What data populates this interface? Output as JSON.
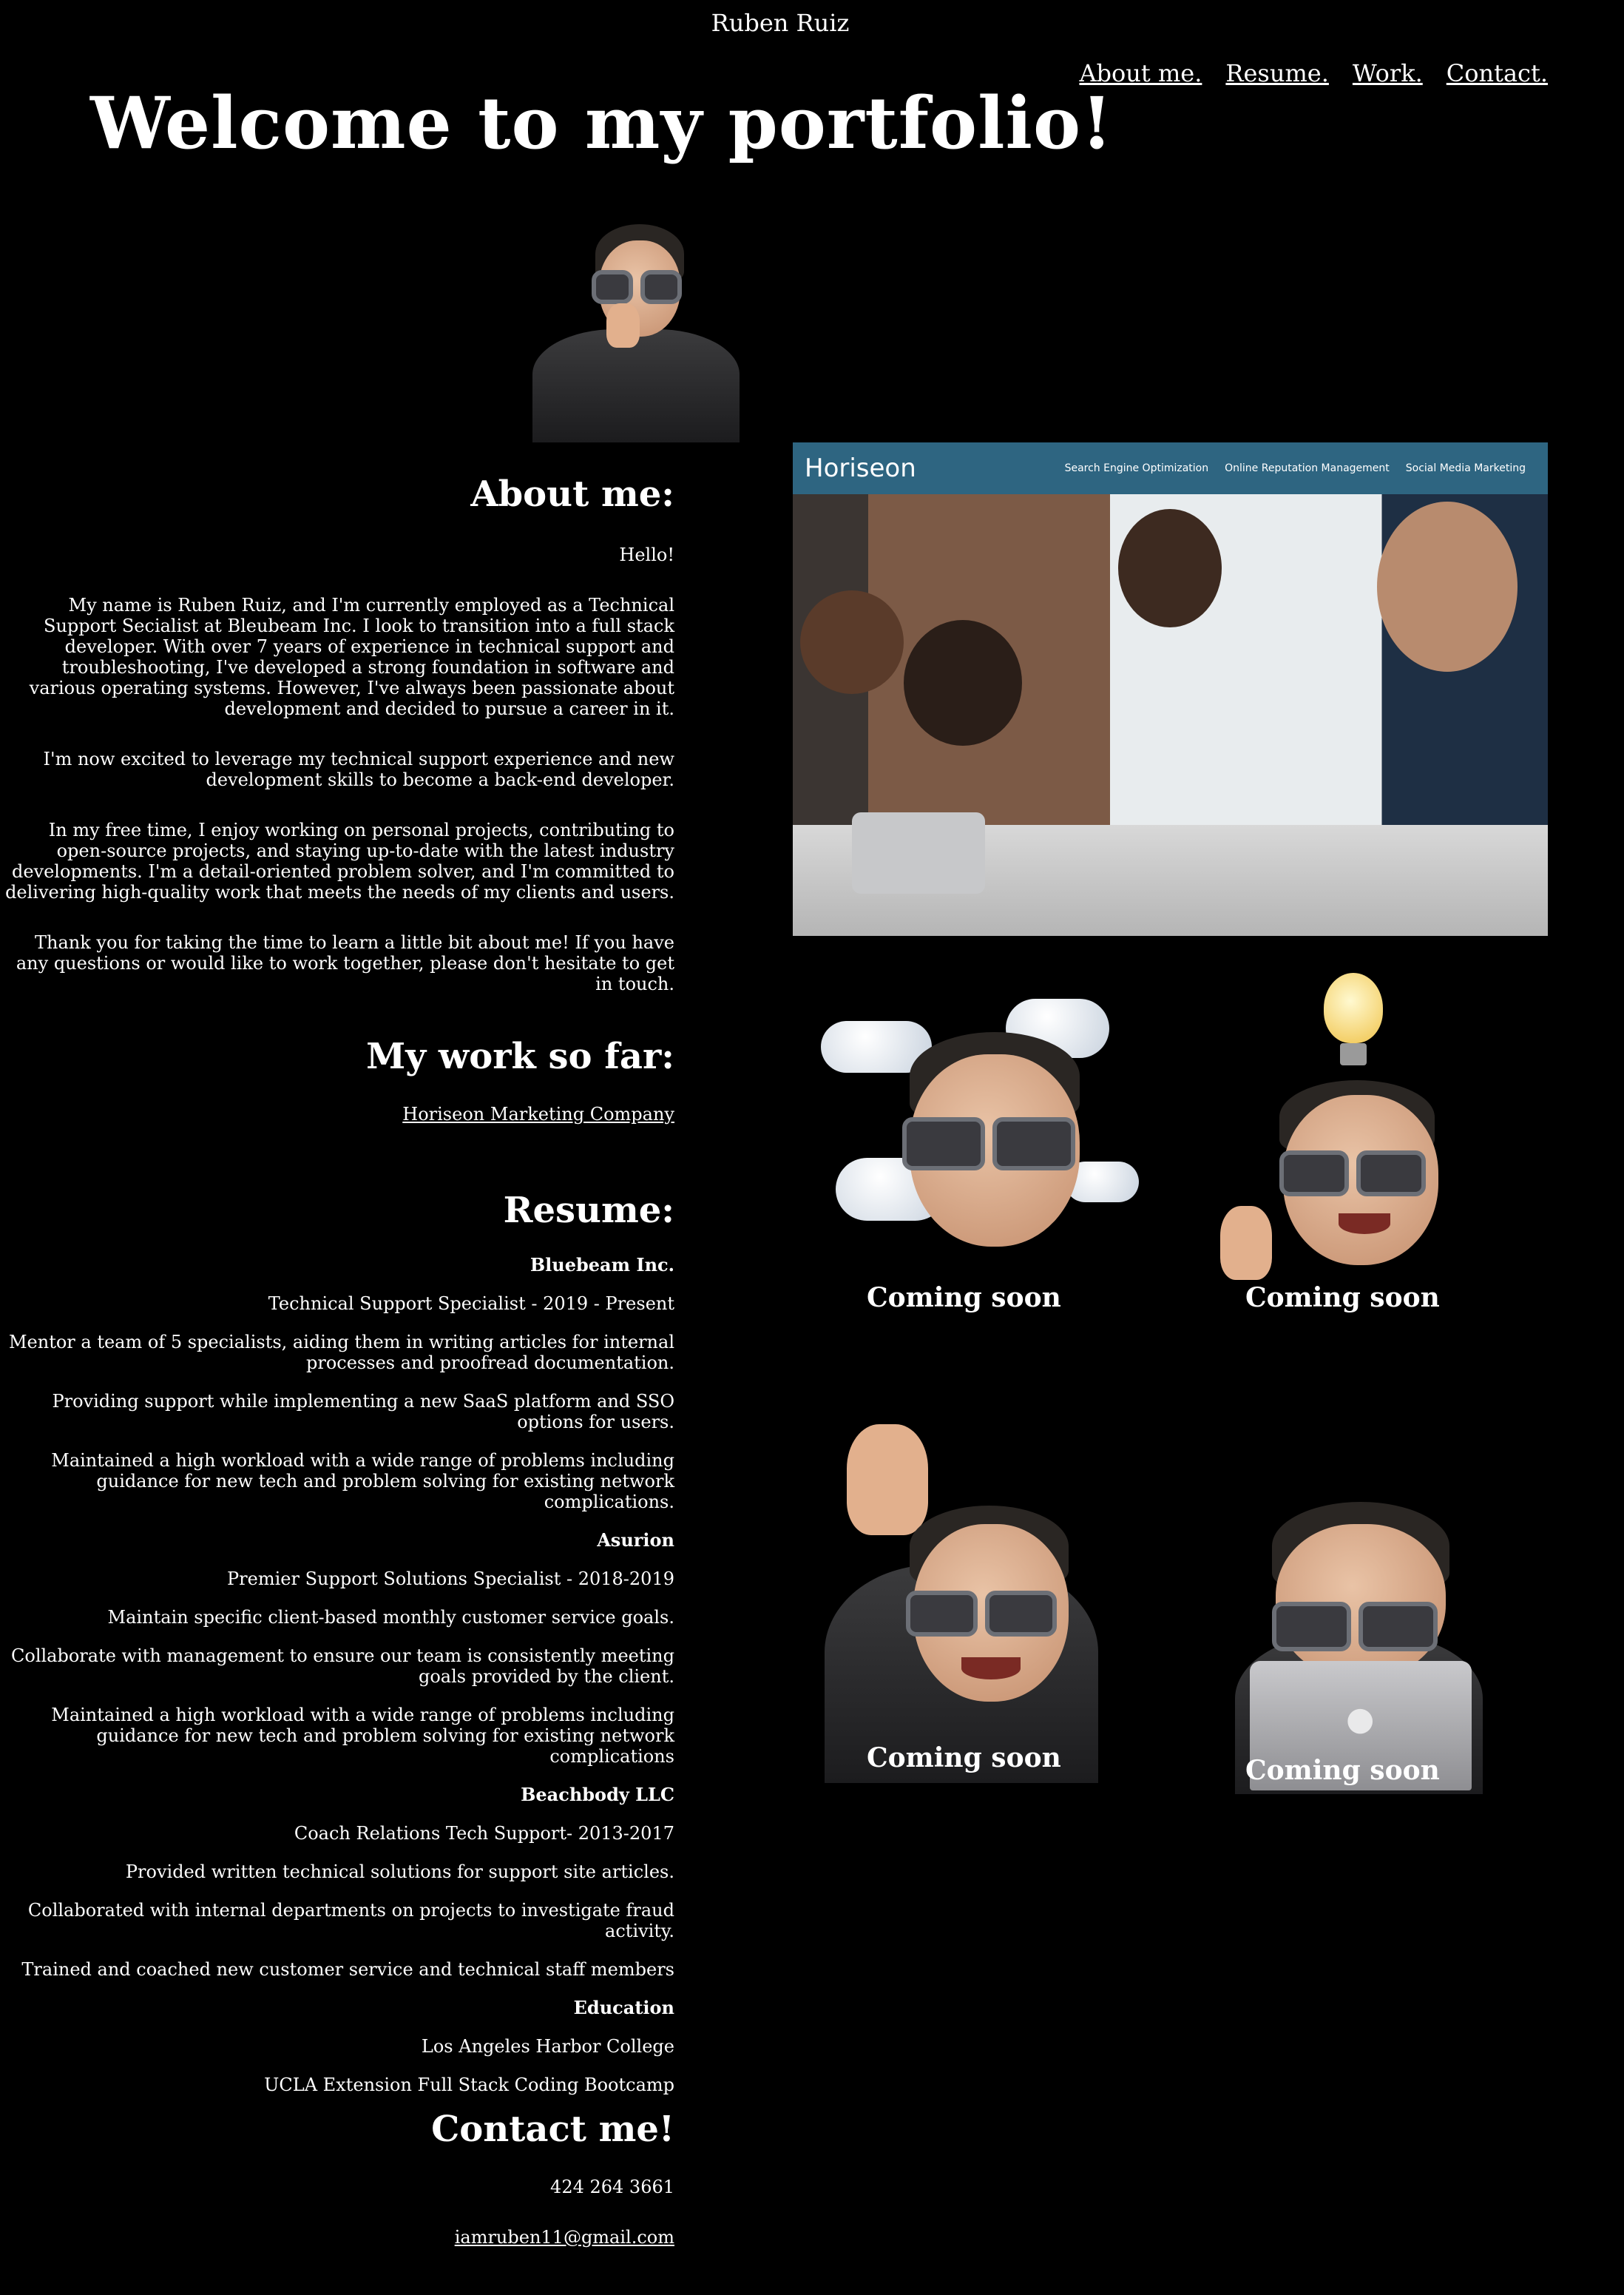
{
  "header": {
    "site_name": "Ruben Ruiz",
    "nav": [
      "About me.",
      "Resume.",
      "Work.",
      "Contact."
    ]
  },
  "hero": {
    "title": "Welcome to my portfolio!"
  },
  "about": {
    "heading": "About me:",
    "paragraphs": [
      "Hello!",
      "My name is Ruben Ruiz, and I'm currently employed as a Technical Support Secialist at Bleubeam Inc. I look to transition into a full stack developer. With over 7 years of experience in technical support and troubleshooting, I've developed a strong foundation in software and various operating systems. However, I've always been passionate about development and decided to pursue a career in it.",
      "I'm now excited to leverage my technical support experience and new development skills to become a back-end developer.",
      "In my free time, I enjoy working on personal projects, contributing to open-source projects, and staying up-to-date with the latest industry developments. I'm a detail-oriented problem solver, and I'm committed to delivering high-quality work that meets the needs of my clients and users.",
      "Thank you for taking the time to learn a little bit about me! If you have any questions or would like to work together, please don't hesitate to get in touch."
    ]
  },
  "work": {
    "heading": "My work so far:",
    "link": "Horiseon Marketing Company",
    "screenshot": {
      "logo": "Horiseon",
      "menu": [
        "Search Engine Optimization",
        "Online Reputation Management",
        "Social Media Marketing"
      ]
    },
    "coming_soon": [
      "Coming soon",
      "Coming soon",
      "Coming soon",
      "Coming soon"
    ]
  },
  "resume": {
    "heading": "Resume:",
    "lines": [
      {
        "text": "Bluebeam Inc.",
        "bold": true
      },
      {
        "text": "Technical Support Specialist - 2019 - Present",
        "bold": false
      },
      {
        "text": "Mentor a team of 5 specialists, aiding them in writing articles for internal processes and proofread documentation.",
        "bold": false
      },
      {
        "text": "Providing support while implementing a new SaaS platform and SSO options for users.",
        "bold": false
      },
      {
        "text": "Maintained a high workload with a wide range of problems including guidance for new tech and problem solving for existing network complications.",
        "bold": false
      },
      {
        "text": "Asurion",
        "bold": true
      },
      {
        "text": "Premier Support Solutions Specialist - 2018-2019",
        "bold": false
      },
      {
        "text": "Maintain specific client-based monthly customer service goals.",
        "bold": false
      },
      {
        "text": "Collaborate with management to ensure our team is consistently meeting goals provided by the client.",
        "bold": false
      },
      {
        "text": "Maintained a high workload with a wide range of problems including guidance for new tech and problem solving for existing network complications",
        "bold": false
      },
      {
        "text": "Beachbody LLC",
        "bold": true
      },
      {
        "text": "Coach Relations Tech Support- 2013-2017",
        "bold": false
      },
      {
        "text": "Provided written technical solutions for support site articles.",
        "bold": false
      },
      {
        "text": "Collaborated with internal departments on projects to investigate fraud activity.",
        "bold": false
      },
      {
        "text": "Trained and coached new customer service and technical staff members",
        "bold": false
      },
      {
        "text": "Education",
        "bold": true
      },
      {
        "text": "Los Angeles Harbor College",
        "bold": false
      },
      {
        "text": "UCLA Extension Full Stack Coding Bootcamp",
        "bold": false
      }
    ]
  },
  "contact": {
    "heading": "Contact me!",
    "phone": "424 264 3661",
    "email": "iamruben11@gmail.com"
  },
  "icons": [
    "memoji-thinking-icon",
    "memoji-clouds-icon",
    "memoji-idea-icon",
    "memoji-wave-icon",
    "memoji-laptop-icon"
  ]
}
